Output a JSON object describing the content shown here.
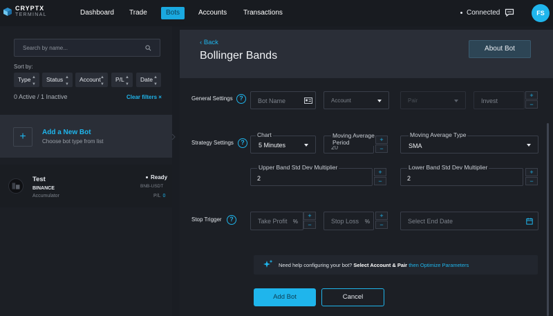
{
  "app": {
    "logo_line1": "CRYPTX",
    "logo_line2": "TERMINAL",
    "brand_color": "#1fb5ec"
  },
  "nav": {
    "items": [
      {
        "label": "Dashboard",
        "active": false
      },
      {
        "label": "Trade",
        "active": false
      },
      {
        "label": "Bots",
        "active": true
      },
      {
        "label": "Accounts",
        "active": false
      },
      {
        "label": "Transactions",
        "active": false
      }
    ]
  },
  "header": {
    "connection_status": "Connected",
    "chat_icon": "chat-bubble-icon",
    "avatar_initials": "FS"
  },
  "sidebar": {
    "search_placeholder": "Search by name...",
    "search_icon": "search-icon",
    "sort_by_label": "Sort by:",
    "sort_options": [
      "Type",
      "Status",
      "Account",
      "P/L",
      "Date"
    ],
    "counts": "0 Active / 1 Inactive",
    "clear_filters": "Clear filters ×",
    "add_bot": {
      "title": "Add a New Bot",
      "subtitle": "Choose bot type from list",
      "icon": "plus-icon"
    },
    "bots": [
      {
        "name": "Test",
        "exchange": "BINANCE",
        "strategy": "Accumulator",
        "status": "Ready",
        "pair": "BNB-USDT",
        "pl_label": "P/L",
        "pl_value": "0"
      }
    ]
  },
  "main": {
    "back_label": "Back",
    "title": "Bollinger Bands",
    "about_button": "About Bot",
    "general": {
      "label": "General Settings",
      "bot_name_placeholder": "Bot Name",
      "account_placeholder": "Account",
      "pair_placeholder": "Pair",
      "invest_placeholder": "Invest"
    },
    "strategy": {
      "label": "Strategy Settings",
      "chart_label": "Chart",
      "chart_value": "5 Minutes",
      "ma_period_label": "Moving Average Period",
      "ma_period_value": "20",
      "ma_type_label": "Moving Average Type",
      "ma_type_value": "SMA",
      "upper_label": "Upper Band Std Dev Multiplier",
      "upper_value": "2",
      "lower_label": "Lower Band Std Dev Multiplier",
      "lower_value": "2"
    },
    "stop": {
      "label": "Stop Trigger",
      "take_profit_placeholder": "Take Profit",
      "stop_loss_placeholder": "Stop Loss",
      "percent": "%",
      "end_date_placeholder": "Select End Date"
    },
    "help_bar": {
      "text": "Need help configuring your bot?",
      "bold": "Select Account & Pair",
      "link": "then Optimize Parameters"
    },
    "add_bot_button": "Add Bot",
    "cancel_button": "Cancel"
  }
}
